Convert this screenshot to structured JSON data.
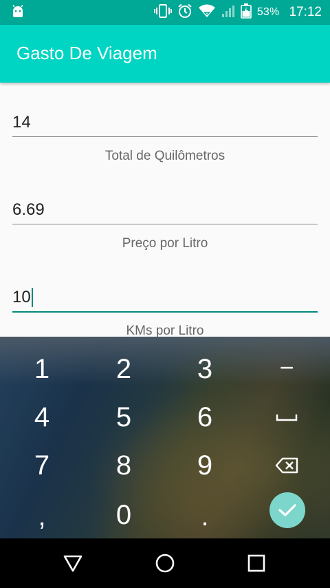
{
  "status_bar": {
    "left_icon": "android-icon",
    "icons": [
      "vibrate-icon",
      "alarm-icon",
      "wifi-icon",
      "signal-icon",
      "battery-icon"
    ],
    "battery_percent": "53%",
    "time": "17:12"
  },
  "app_bar": {
    "title": "Gasto De Viagem"
  },
  "form": {
    "fields": [
      {
        "value": "14",
        "hint": "Total de Quilômetros"
      },
      {
        "value": "6.69",
        "hint": "Preço por Litro"
      },
      {
        "value": "10",
        "hint": "KMs por Litro"
      }
    ]
  },
  "keyboard": {
    "keys": [
      "1",
      "2",
      "3",
      "−",
      "4",
      "5",
      "6",
      "␣",
      "7",
      "8",
      "9",
      "⌫",
      ",",
      "0",
      "."
    ],
    "done_icon": "check-icon"
  },
  "nav_bar": {
    "back_icon": "back-triangle-icon",
    "home_icon": "home-circle-icon",
    "recents_icon": "recents-square-icon"
  },
  "colors": {
    "status_bar": "#00a896",
    "app_bar": "#00d4c2",
    "accent": "#00897b",
    "done_key": "#7dd6cb"
  }
}
